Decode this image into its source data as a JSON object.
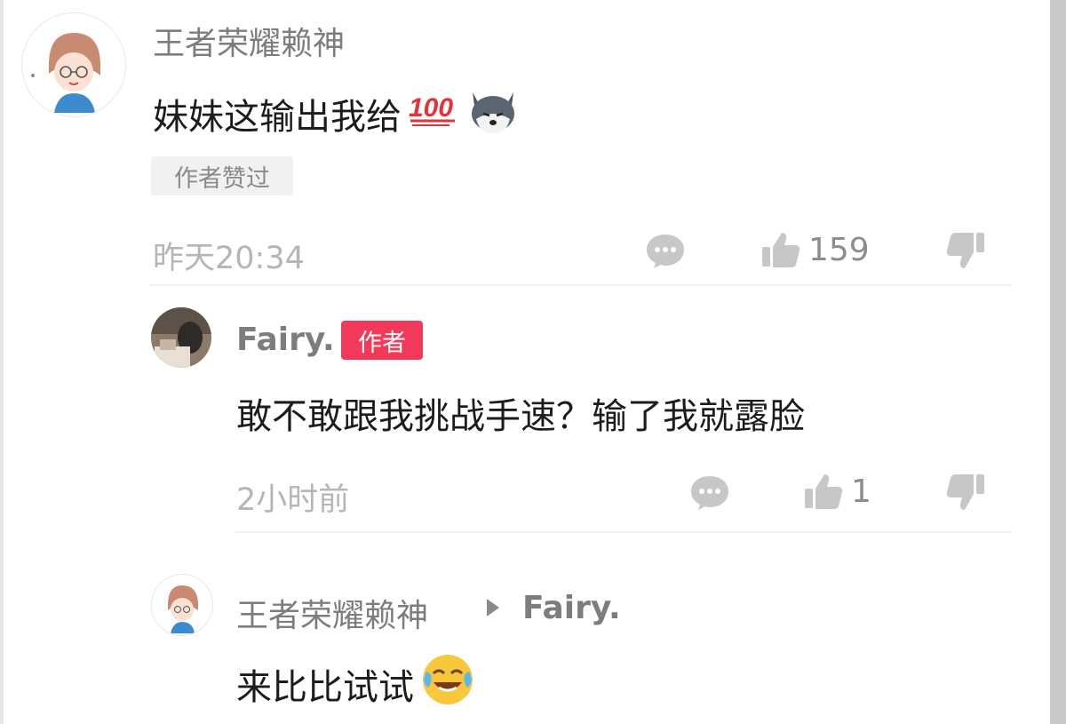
{
  "comment": {
    "username": "王者荣耀赖神",
    "text": "妹妹这输出我给",
    "emoji_score": "100",
    "liked_badge": "作者赞过",
    "time": "昨天20:34",
    "likes": "159"
  },
  "reply1": {
    "username": "Fairy.",
    "author_tag": "作者",
    "text": "敢不敢跟我挑战手速？输了我就露脸",
    "time": "2小时前",
    "likes": "1"
  },
  "reply2": {
    "username": "王者荣耀赖神",
    "target": "Fairy.",
    "text": "来比比试试"
  },
  "colors": {
    "author_tag": "#f2395a",
    "meta_gray": "#b5b5b5",
    "name_gray": "#7d7d7d"
  }
}
